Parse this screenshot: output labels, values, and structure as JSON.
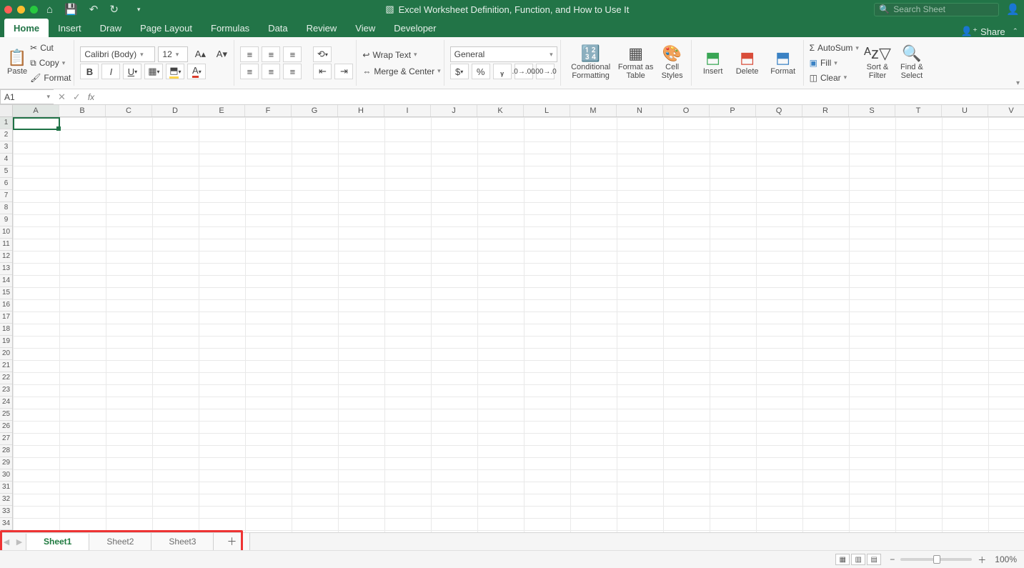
{
  "window": {
    "title": "Excel Worksheet Definition, Function, and How to Use It"
  },
  "search": {
    "placeholder": "Search Sheet"
  },
  "ribbon_tabs": [
    "Home",
    "Insert",
    "Draw",
    "Page Layout",
    "Formulas",
    "Data",
    "Review",
    "View",
    "Developer"
  ],
  "share_label": "Share",
  "clipboard": {
    "paste": "Paste",
    "cut": "Cut",
    "copy": "Copy",
    "format": "Format"
  },
  "font": {
    "name": "Calibri (Body)",
    "size": "12"
  },
  "alignment": {
    "wrap": "Wrap Text",
    "merge": "Merge & Center"
  },
  "number_format": "General",
  "style_btns": {
    "cond": "Conditional Formatting",
    "table": "Format as Table",
    "styles": "Cell Styles"
  },
  "cells_btns": {
    "insert": "Insert",
    "delete": "Delete",
    "format": "Format"
  },
  "editing": {
    "autosum": "AutoSum",
    "fill": "Fill",
    "clear": "Clear",
    "sort": "Sort & Filter",
    "find": "Find & Select"
  },
  "namebox": "A1",
  "columns": [
    "A",
    "B",
    "C",
    "D",
    "E",
    "F",
    "G",
    "H",
    "I",
    "J",
    "K",
    "L",
    "M",
    "N",
    "O",
    "P",
    "Q",
    "R",
    "S",
    "T",
    "U",
    "V"
  ],
  "rows_count": 35,
  "sheets": [
    "Sheet1",
    "Sheet2",
    "Sheet3"
  ],
  "zoom": "100%"
}
